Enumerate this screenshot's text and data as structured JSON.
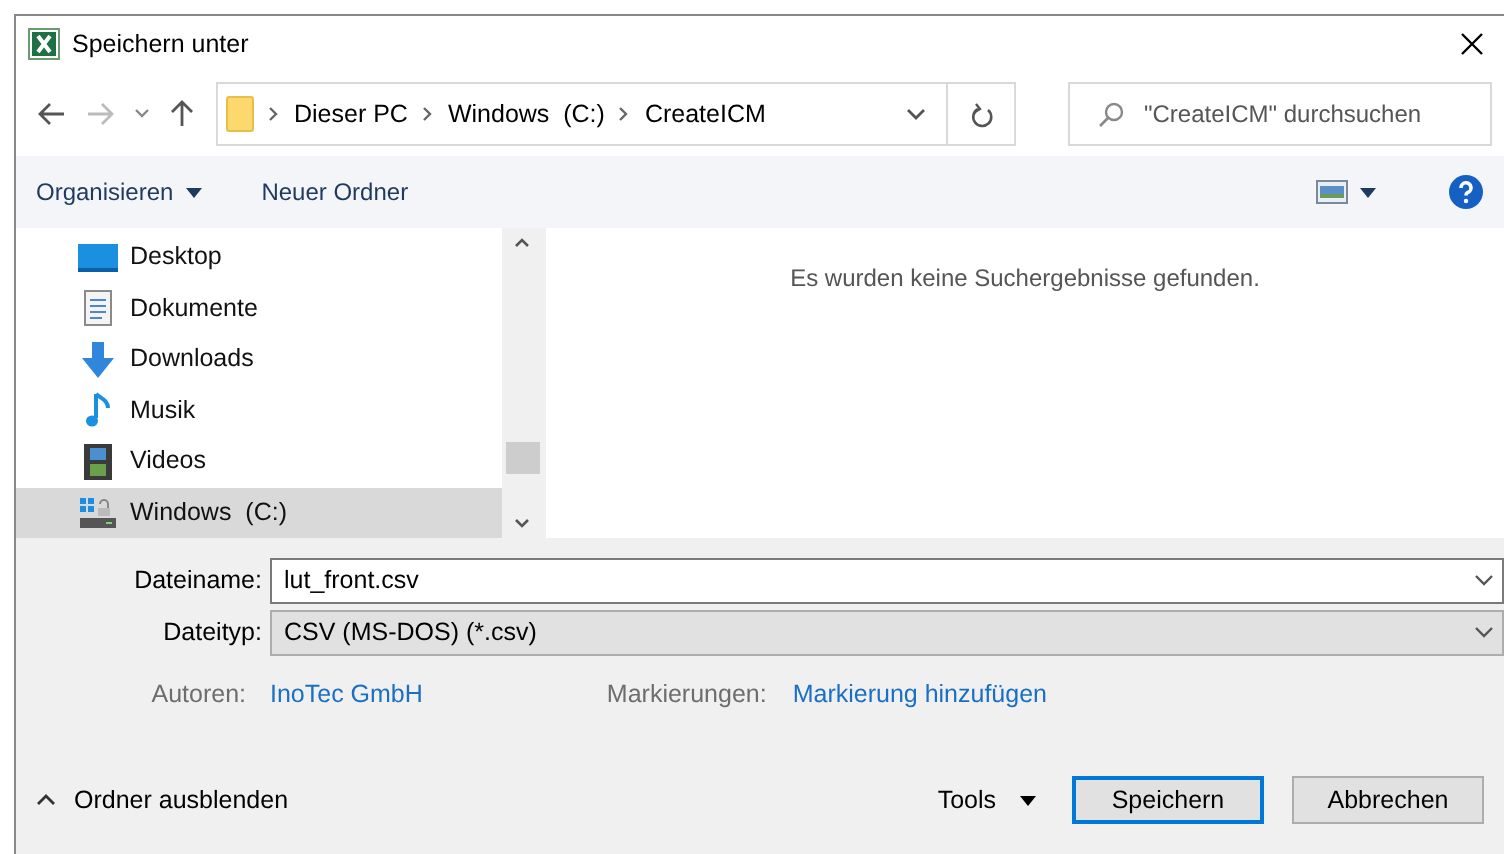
{
  "window": {
    "title": "Speichern unter"
  },
  "breadcrumb": [
    "Dieser PC",
    "Windows  (C:)",
    "CreateICM"
  ],
  "search": {
    "placeholder": "\"CreateICM\" durchsuchen"
  },
  "toolbar": {
    "organize": "Organisieren",
    "new_folder": "Neuer Ordner"
  },
  "sidebar": {
    "items": [
      {
        "label": "Desktop",
        "kind": "desktop",
        "selected": false
      },
      {
        "label": "Dokumente",
        "kind": "documents",
        "selected": false
      },
      {
        "label": "Downloads",
        "kind": "downloads",
        "selected": false
      },
      {
        "label": "Musik",
        "kind": "music",
        "selected": false
      },
      {
        "label": "Videos",
        "kind": "videos",
        "selected": false
      },
      {
        "label": "Windows  (C:)",
        "kind": "drive",
        "selected": true
      }
    ]
  },
  "content": {
    "message": "Es wurden keine Suchergebnisse gefunden."
  },
  "form": {
    "filename_label": "Dateiname:",
    "filename": "lut_front.csv",
    "filetype_label": "Dateityp:",
    "filetype": "CSV (MS-DOS) (*.csv)",
    "authors_label": "Autoren:",
    "authors": "InoTec GmbH",
    "tags_label": "Markierungen:",
    "tags": "Markierung hinzufügen"
  },
  "footer": {
    "hide_folders": "Ordner ausblenden",
    "tools": "Tools",
    "save": "Speichern",
    "cancel": "Abbrechen"
  }
}
